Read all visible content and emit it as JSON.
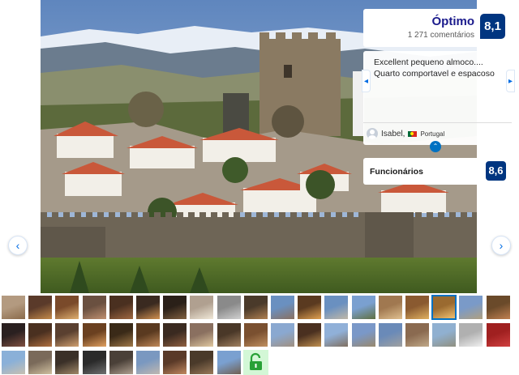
{
  "score": {
    "label": "Óptimo",
    "count": "1 271 comentários",
    "value": "8,1"
  },
  "review": {
    "text": "Excellent pequeno almoco.... Quarto comportavel e espacoso",
    "reviewer_name": "Isabel,",
    "reviewer_country": "Portugal"
  },
  "staff": {
    "label": "Funcionários",
    "value": "8,6"
  },
  "icons": {
    "prev": "chevron-left-icon",
    "next": "chevron-right-icon",
    "collapse": "chevron-up-icon",
    "unlock": "unlock-icon",
    "avatar": "user-avatar-icon",
    "flag": "portugal-flag-icon"
  },
  "glyphs": {
    "prev": "‹",
    "next": "›",
    "review_prev": "◂",
    "review_next": "▸",
    "collapse": "⌃"
  },
  "colors": {
    "brand": "#003580",
    "accent": "#0071c2",
    "lock_bg": "#d3f7d6",
    "lock_icon": "#27a136"
  },
  "thumbnails": [
    [
      "#b39a80",
      "#8a6a4a"
    ],
    [
      "#5a3a2a",
      "#c48a4a"
    ],
    [
      "#7a4a2a",
      "#e0b070"
    ],
    [
      "#6a5040",
      "#c09070"
    ],
    [
      "#4a3020",
      "#a06840"
    ],
    [
      "#3a2a20",
      "#d09050"
    ],
    [
      "#2a2018",
      "#806040"
    ],
    [
      "#b0a090",
      "#f0e8d8"
    ],
    [
      "#8a8a8a",
      "#d0d0d0"
    ],
    [
      "#4a3a2a",
      "#b08050"
    ],
    [
      "#6a90c0",
      "#8a7060"
    ],
    [
      "#5a3a20",
      "#e0a050"
    ],
    [
      "#6a90c0",
      "#c0b8a8"
    ],
    [
      "#7aa0d0",
      "#607040"
    ],
    [
      "#a07850",
      "#e0c090"
    ],
    [
      "#8a5a30",
      "#e0b060"
    ],
    [
      "#9a6a30",
      "#f0c070"
    ],
    [
      "#7a9ac8",
      "#b0a080"
    ],
    [
      "#6a4a2a",
      "#c08050"
    ],
    [
      "#2a2020",
      "#805040"
    ],
    [
      "#4a3020",
      "#b07040"
    ],
    [
      "#5a4030",
      "#d0a070"
    ],
    [
      "#6a4020",
      "#e0a060"
    ],
    [
      "#3a2a18",
      "#a07848"
    ],
    [
      "#5a3a20",
      "#c08858"
    ],
    [
      "#3a2a20",
      "#906040"
    ],
    [
      "#8a7060",
      "#e0c8a0"
    ],
    [
      "#4a3828",
      "#a08060"
    ],
    [
      "#7a5030",
      "#c09060"
    ],
    [
      "#8aa8d0",
      "#a09080"
    ],
    [
      "#4a3020",
      "#c09050"
    ],
    [
      "#90b0d8",
      "#807060"
    ],
    [
      "#7a98c8",
      "#98886c"
    ],
    [
      "#6a8ab8",
      "#a0a0a0"
    ],
    [
      "#8a6a50",
      "#c0a888"
    ],
    [
      "#90b0d0",
      "#909080"
    ],
    [
      "#b0b0b0",
      "#f0f0f0"
    ],
    [
      "#a02020",
      "#d04040"
    ],
    [
      "#8ab0d8",
      "#c8c0b0"
    ],
    [
      "#7a6a5a",
      "#d0c0a0"
    ],
    [
      "#3a3028",
      "#a08868"
    ],
    [
      "#2a2a2a",
      "#707070"
    ],
    [
      "#4a4038",
      "#b0a090"
    ],
    [
      "#7a98c0",
      "#c0b8b0"
    ],
    [
      "#5a3a28",
      "#c08860"
    ],
    [
      "#4a3a2a",
      "#9a7a5a"
    ],
    [
      "#7aa0d0",
      "#706050"
    ]
  ],
  "active_thumbnail": 16
}
